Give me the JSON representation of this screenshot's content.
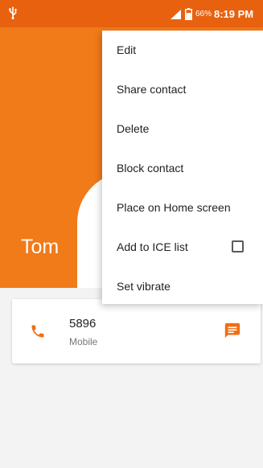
{
  "status_bar": {
    "battery_percent": "66%",
    "time": "8:19 PM",
    "icons": [
      "usb-icon",
      "signal-icon",
      "battery-icon"
    ],
    "color": "#e8610f"
  },
  "header": {
    "contact_name": "Tom",
    "color": "#f17a19"
  },
  "phone_entry": {
    "number": "5896",
    "type": "Mobile",
    "icons": [
      "call-icon",
      "message-icon"
    ],
    "accent_color": "#ee6e14"
  },
  "menu": {
    "items": [
      {
        "label": "Edit"
      },
      {
        "label": "Share contact"
      },
      {
        "label": "Delete"
      },
      {
        "label": "Block contact"
      },
      {
        "label": "Place on Home screen"
      },
      {
        "label": "Add to ICE list",
        "checkbox": false
      },
      {
        "label": "Set vibrate"
      }
    ]
  }
}
